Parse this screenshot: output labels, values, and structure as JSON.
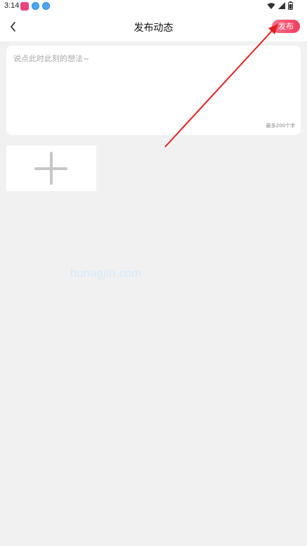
{
  "status_bar": {
    "time": "3:14",
    "app_icons": [
      "pink-app-icon",
      "blue-circle-icon",
      "blue-circle-icon"
    ],
    "right_icons": [
      "wifi-icon",
      "signal-icon",
      "battery-icon"
    ]
  },
  "header": {
    "title": "发布动态",
    "publish_label": "发布",
    "back_icon": "chevron-left-icon"
  },
  "composer": {
    "placeholder": "说点此时此刻的想法~",
    "char_limit": "最多200个字"
  },
  "media": {
    "add_icon": "plus-icon"
  },
  "watermark": "hunagjin.com",
  "colors": {
    "publish_gradient_start": "#fb6d8a",
    "publish_gradient_end": "#ef3e5f",
    "annotation_arrow": "#e02020",
    "background": "#f1f1f1"
  }
}
